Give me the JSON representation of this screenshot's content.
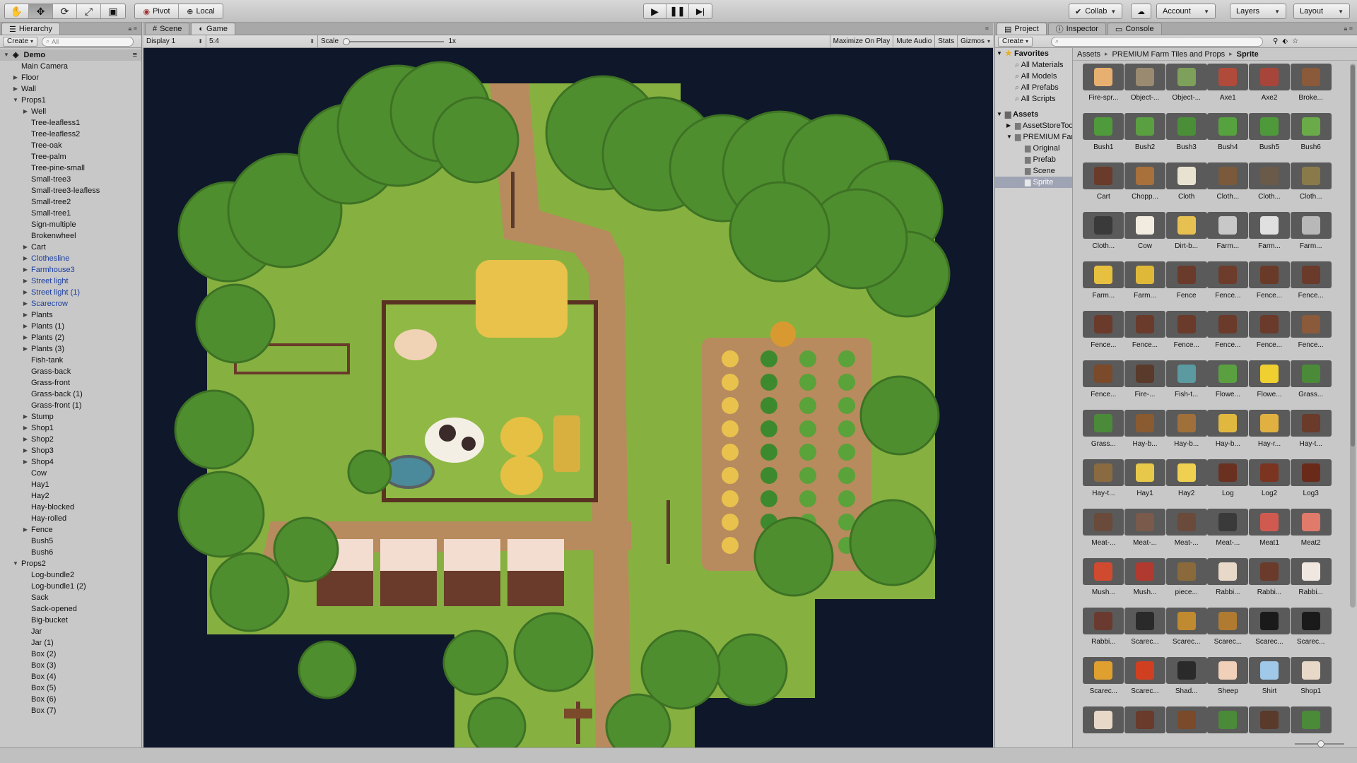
{
  "toolbar": {
    "transform_tools": [
      {
        "name": "hand-tool-icon",
        "glyph": "✋"
      },
      {
        "name": "move-tool-icon",
        "glyph": "✥"
      },
      {
        "name": "rotate-tool-icon",
        "glyph": "⟳"
      },
      {
        "name": "scale-tool-icon",
        "glyph": "⤢"
      },
      {
        "name": "rect-tool-icon",
        "glyph": "▣"
      }
    ],
    "pivot_label": "Pivot",
    "local_label": "Local",
    "collab_label": "Collab",
    "account_label": "Account",
    "layers_label": "Layers",
    "layout_label": "Layout"
  },
  "hierarchy": {
    "tab_label": "Hierarchy",
    "create_label": "Create",
    "search_placeholder": "All",
    "scene_name": "Demo",
    "items": [
      {
        "label": "Main Camera",
        "indent": 1,
        "arrow": "",
        "prefab": false
      },
      {
        "label": "Floor",
        "indent": 1,
        "arrow": "▶",
        "prefab": false
      },
      {
        "label": "Wall",
        "indent": 1,
        "arrow": "▶",
        "prefab": false
      },
      {
        "label": "Props1",
        "indent": 1,
        "arrow": "▼",
        "prefab": false
      },
      {
        "label": "Well",
        "indent": 2,
        "arrow": "▶",
        "prefab": false
      },
      {
        "label": "Tree-leafless1",
        "indent": 2,
        "arrow": "",
        "prefab": false
      },
      {
        "label": "Tree-leafless2",
        "indent": 2,
        "arrow": "",
        "prefab": false
      },
      {
        "label": "Tree-oak",
        "indent": 2,
        "arrow": "",
        "prefab": false
      },
      {
        "label": "Tree-palm",
        "indent": 2,
        "arrow": "",
        "prefab": false
      },
      {
        "label": "Tree-pine-small",
        "indent": 2,
        "arrow": "",
        "prefab": false
      },
      {
        "label": "Small-tree3",
        "indent": 2,
        "arrow": "",
        "prefab": false
      },
      {
        "label": "Small-tree3-leafless",
        "indent": 2,
        "arrow": "",
        "prefab": false
      },
      {
        "label": "Small-tree2",
        "indent": 2,
        "arrow": "",
        "prefab": false
      },
      {
        "label": "Small-tree1",
        "indent": 2,
        "arrow": "",
        "prefab": false
      },
      {
        "label": "Sign-multiple",
        "indent": 2,
        "arrow": "",
        "prefab": false
      },
      {
        "label": "Brokenwheel",
        "indent": 2,
        "arrow": "",
        "prefab": false
      },
      {
        "label": "Cart",
        "indent": 2,
        "arrow": "▶",
        "prefab": false
      },
      {
        "label": "Clothesline",
        "indent": 2,
        "arrow": "▶",
        "prefab": true
      },
      {
        "label": "Farmhouse3",
        "indent": 2,
        "arrow": "▶",
        "prefab": true
      },
      {
        "label": "Street light",
        "indent": 2,
        "arrow": "▶",
        "prefab": true
      },
      {
        "label": "Street light (1)",
        "indent": 2,
        "arrow": "▶",
        "prefab": true
      },
      {
        "label": "Scarecrow",
        "indent": 2,
        "arrow": "▶",
        "prefab": true
      },
      {
        "label": "Plants",
        "indent": 2,
        "arrow": "▶",
        "prefab": false
      },
      {
        "label": "Plants (1)",
        "indent": 2,
        "arrow": "▶",
        "prefab": false
      },
      {
        "label": "Plants (2)",
        "indent": 2,
        "arrow": "▶",
        "prefab": false
      },
      {
        "label": "Plants (3)",
        "indent": 2,
        "arrow": "▶",
        "prefab": false
      },
      {
        "label": "Fish-tank",
        "indent": 2,
        "arrow": "",
        "prefab": false
      },
      {
        "label": "Grass-back",
        "indent": 2,
        "arrow": "",
        "prefab": false
      },
      {
        "label": "Grass-front",
        "indent": 2,
        "arrow": "",
        "prefab": false
      },
      {
        "label": "Grass-back (1)",
        "indent": 2,
        "arrow": "",
        "prefab": false
      },
      {
        "label": "Grass-front (1)",
        "indent": 2,
        "arrow": "",
        "prefab": false
      },
      {
        "label": "Stump",
        "indent": 2,
        "arrow": "▶",
        "prefab": false
      },
      {
        "label": "Shop1",
        "indent": 2,
        "arrow": "▶",
        "prefab": false
      },
      {
        "label": "Shop2",
        "indent": 2,
        "arrow": "▶",
        "prefab": false
      },
      {
        "label": "Shop3",
        "indent": 2,
        "arrow": "▶",
        "prefab": false
      },
      {
        "label": "Shop4",
        "indent": 2,
        "arrow": "▶",
        "prefab": false
      },
      {
        "label": "Cow",
        "indent": 2,
        "arrow": "",
        "prefab": false
      },
      {
        "label": "Hay1",
        "indent": 2,
        "arrow": "",
        "prefab": false
      },
      {
        "label": "Hay2",
        "indent": 2,
        "arrow": "",
        "prefab": false
      },
      {
        "label": "Hay-blocked",
        "indent": 2,
        "arrow": "",
        "prefab": false
      },
      {
        "label": "Hay-rolled",
        "indent": 2,
        "arrow": "",
        "prefab": false
      },
      {
        "label": "Fence",
        "indent": 2,
        "arrow": "▶",
        "prefab": false
      },
      {
        "label": "Bush5",
        "indent": 2,
        "arrow": "",
        "prefab": false
      },
      {
        "label": "Bush6",
        "indent": 2,
        "arrow": "",
        "prefab": false
      },
      {
        "label": "Props2",
        "indent": 1,
        "arrow": "▼",
        "prefab": false
      },
      {
        "label": "Log-bundle2",
        "indent": 2,
        "arrow": "",
        "prefab": false
      },
      {
        "label": "Log-bundle1 (2)",
        "indent": 2,
        "arrow": "",
        "prefab": false
      },
      {
        "label": "Sack",
        "indent": 2,
        "arrow": "",
        "prefab": false
      },
      {
        "label": "Sack-opened",
        "indent": 2,
        "arrow": "",
        "prefab": false
      },
      {
        "label": "Big-bucket",
        "indent": 2,
        "arrow": "",
        "prefab": false
      },
      {
        "label": "Jar",
        "indent": 2,
        "arrow": "",
        "prefab": false
      },
      {
        "label": "Jar (1)",
        "indent": 2,
        "arrow": "",
        "prefab": false
      },
      {
        "label": "Box (2)",
        "indent": 2,
        "arrow": "",
        "prefab": false
      },
      {
        "label": "Box (3)",
        "indent": 2,
        "arrow": "",
        "prefab": false
      },
      {
        "label": "Box (4)",
        "indent": 2,
        "arrow": "",
        "prefab": false
      },
      {
        "label": "Box (5)",
        "indent": 2,
        "arrow": "",
        "prefab": false
      },
      {
        "label": "Box (6)",
        "indent": 2,
        "arrow": "",
        "prefab": false
      },
      {
        "label": "Box (7)",
        "indent": 2,
        "arrow": "",
        "prefab": false
      }
    ]
  },
  "game": {
    "scene_tab": "Scene",
    "game_tab": "Game",
    "display": "Display 1",
    "aspect": "5:4",
    "scale_label": "Scale",
    "scale_value": "1x",
    "scale_fraction": 0.0,
    "maximize": "Maximize On Play",
    "mute": "Mute Audio",
    "stats": "Stats",
    "gizmos": "Gizmos"
  },
  "project": {
    "project_tab": "Project",
    "inspector_tab": "Inspector",
    "console_tab": "Console",
    "create_label": "Create",
    "favorites_label": "Favorites",
    "favorites": [
      "All Materials",
      "All Models",
      "All Prefabs",
      "All Scripts"
    ],
    "assets_label": "Assets",
    "folders": [
      {
        "label": "AssetStoreTools",
        "indent": 1,
        "arrow": "▶",
        "selected": false
      },
      {
        "label": "PREMIUM Farm Tiles and Props",
        "indent": 1,
        "arrow": "▼",
        "selected": false
      },
      {
        "label": "Original",
        "indent": 2,
        "arrow": "",
        "selected": false
      },
      {
        "label": "Prefab",
        "indent": 2,
        "arrow": "",
        "selected": false
      },
      {
        "label": "Scene",
        "indent": 2,
        "arrow": "",
        "selected": false
      },
      {
        "label": "Sprite",
        "indent": 2,
        "arrow": "",
        "selected": true
      }
    ],
    "breadcrumb": [
      "Assets",
      "PREMIUM Farm Tiles and Props",
      "Sprite"
    ],
    "assets": [
      {
        "label": "Fire-spr...",
        "color": "#e8b070"
      },
      {
        "label": "Object-...",
        "color": "#9a8a70"
      },
      {
        "label": "Object-...",
        "color": "#7da05a"
      },
      {
        "label": "Axe1",
        "color": "#b04a3a"
      },
      {
        "label": "Axe2",
        "color": "#a8453a"
      },
      {
        "label": "Broke...",
        "color": "#8a5a3a"
      },
      {
        "label": "Bush1",
        "color": "#4f9a3a"
      },
      {
        "label": "Bush2",
        "color": "#5aa040"
      },
      {
        "label": "Bush3",
        "color": "#4a8f38"
      },
      {
        "label": "Bush4",
        "color": "#56a23e"
      },
      {
        "label": "Bush5",
        "color": "#4e9a3a"
      },
      {
        "label": "Bush6",
        "color": "#6aaa48"
      },
      {
        "label": "Cart",
        "color": "#6a3a2a"
      },
      {
        "label": "Chopp...",
        "color": "#a8703a"
      },
      {
        "label": "Cloth",
        "color": "#e8e2d0"
      },
      {
        "label": "Cloth...",
        "color": "#7a5a3a"
      },
      {
        "label": "Cloth...",
        "color": "#6a5a4a"
      },
      {
        "label": "Cloth...",
        "color": "#8a7a4a"
      },
      {
        "label": "Cloth...",
        "color": "#3a3a3a"
      },
      {
        "label": "Cow",
        "color": "#f2ece0"
      },
      {
        "label": "Dirt-b...",
        "color": "#e6c050"
      },
      {
        "label": "Farm...",
        "color": "#c8c8c8"
      },
      {
        "label": "Farm...",
        "color": "#e0e0e0"
      },
      {
        "label": "Farm...",
        "color": "#b8b8b8"
      },
      {
        "label": "Farm...",
        "color": "#e8c040"
      },
      {
        "label": "Farm...",
        "color": "#e0b838"
      },
      {
        "label": "Fence",
        "color": "#6a3a2a"
      },
      {
        "label": "Fence...",
        "color": "#6e3c2a"
      },
      {
        "label": "Fence...",
        "color": "#6a3a28"
      },
      {
        "label": "Fence...",
        "color": "#6a3a2a"
      },
      {
        "label": "Fence...",
        "color": "#6a3a2a"
      },
      {
        "label": "Fence...",
        "color": "#6a3a2a"
      },
      {
        "label": "Fence...",
        "color": "#6a3a2a"
      },
      {
        "label": "Fence...",
        "color": "#6a3a2a"
      },
      {
        "label": "Fence...",
        "color": "#6a3a2a"
      },
      {
        "label": "Fence...",
        "color": "#8a5a3a"
      },
      {
        "label": "Fence...",
        "color": "#7a4a2a"
      },
      {
        "label": "Fire-...",
        "color": "#5a3a2a"
      },
      {
        "label": "Fish-t...",
        "color": "#5a9aa0"
      },
      {
        "label": "Flowe...",
        "color": "#5aa040"
      },
      {
        "label": "Flowe...",
        "color": "#f0d030"
      },
      {
        "label": "Grass...",
        "color": "#4a8a38"
      },
      {
        "label": "Grass...",
        "color": "#4a8a38"
      },
      {
        "label": "Hay-b...",
        "color": "#8a5a30"
      },
      {
        "label": "Hay-b...",
        "color": "#a0703a"
      },
      {
        "label": "Hay-b...",
        "color": "#e0b840"
      },
      {
        "label": "Hay-r...",
        "color": "#e0b040"
      },
      {
        "label": "Hay-t...",
        "color": "#6a3a2a"
      },
      {
        "label": "Hay-t...",
        "color": "#8a6a40"
      },
      {
        "label": "Hay1",
        "color": "#e8c848"
      },
      {
        "label": "Hay2",
        "color": "#f0d050"
      },
      {
        "label": "Log",
        "color": "#6a3020"
      },
      {
        "label": "Log2",
        "color": "#7a3420"
      },
      {
        "label": "Log3",
        "color": "#6a2a1a"
      },
      {
        "label": "Meat-...",
        "color": "#6a4a3a"
      },
      {
        "label": "Meat-...",
        "color": "#7a5a4a"
      },
      {
        "label": "Meat-...",
        "color": "#6a4a3a"
      },
      {
        "label": "Meat-...",
        "color": "#3a3a3a"
      },
      {
        "label": "Meat1",
        "color": "#d05a50"
      },
      {
        "label": "Meat2",
        "color": "#e07a6a"
      },
      {
        "label": "Mush...",
        "color": "#d04a30"
      },
      {
        "label": "Mush...",
        "color": "#b03a30"
      },
      {
        "label": "piece...",
        "color": "#8a6a3a"
      },
      {
        "label": "Rabbi...",
        "color": "#e8d8c8"
      },
      {
        "label": "Rabbi...",
        "color": "#6a3a2a"
      },
      {
        "label": "Rabbi...",
        "color": "#f0e8e0"
      },
      {
        "label": "Rabbi...",
        "color": "#6a3a30"
      },
      {
        "label": "Scarec...",
        "color": "#2a2a2a"
      },
      {
        "label": "Scarec...",
        "color": "#c08a30"
      },
      {
        "label": "Scarec...",
        "color": "#b07a30"
      },
      {
        "label": "Scarec...",
        "color": "#1a1a1a"
      },
      {
        "label": "Scarec...",
        "color": "#1a1a1a"
      },
      {
        "label": "Scarec...",
        "color": "#e0a030"
      },
      {
        "label": "Scarec...",
        "color": "#d04020"
      },
      {
        "label": "Shad...",
        "color": "#2a2a2a"
      },
      {
        "label": "Sheep",
        "color": "#f0d0b8"
      },
      {
        "label": "Shirt",
        "color": "#a0c8e8"
      },
      {
        "label": "Shop1",
        "color": "#e8d8c8"
      },
      {
        "label": "",
        "color": "#e8d8c8"
      },
      {
        "label": "",
        "color": "#6a3a2a"
      },
      {
        "label": "",
        "color": "#7a4a2a"
      },
      {
        "label": "",
        "color": "#4a8a38"
      },
      {
        "label": "",
        "color": "#5a3a2a"
      },
      {
        "label": "",
        "color": "#4a8a38"
      }
    ]
  },
  "colors": {
    "grass": "#86b140",
    "dark_grass": "#6d9a33",
    "dirt": "#b78b5d",
    "tree": "#4f8e2f",
    "background": "#0f172a"
  }
}
